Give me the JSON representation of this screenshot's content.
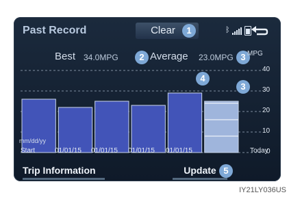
{
  "screen": {
    "title": "Past Record"
  },
  "header": {
    "clear_label": "Clear"
  },
  "stats": {
    "best_label": "Best",
    "best_value": "34.0MPG",
    "average_label": "Average",
    "average_value": "23.0MPG",
    "unit": "MPG"
  },
  "chart_data": {
    "type": "bar",
    "categories": [
      "Start",
      "01/01/15",
      "01/01/15",
      "01/01/15",
      "01/01/15",
      "Today"
    ],
    "values": [
      26,
      22,
      25,
      23,
      29,
      25
    ],
    "ylim": [
      0,
      40
    ],
    "yticks": [
      "40",
      "30",
      "20",
      "10",
      "0"
    ],
    "date_format_label": "mm/dd/yy",
    "bar_color": "#4254b8",
    "today_bar_color": "#9fb5dc",
    "grid": true
  },
  "footer": {
    "trip_info_label": "Trip Information",
    "update_label": "Update"
  },
  "callouts": [
    "1",
    "2",
    "3",
    "4",
    "3",
    "5"
  ],
  "image_code": "IY21LY036US"
}
